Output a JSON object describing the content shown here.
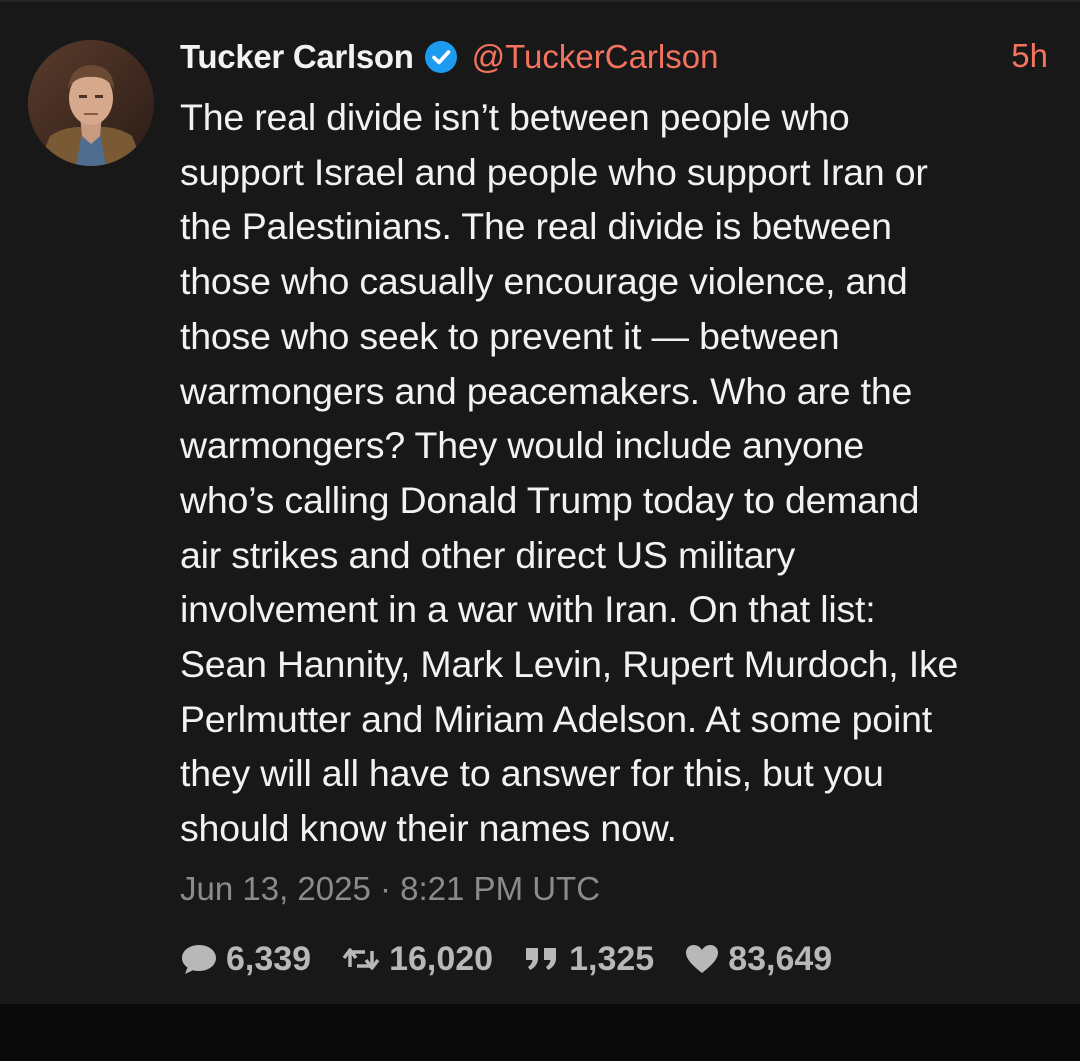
{
  "tweet": {
    "author": {
      "display_name": "Tucker Carlson",
      "handle": "@TuckerCarlson",
      "verified": true
    },
    "time_ago": "5h",
    "text": "The real divide isn’t between people who\nsupport Israel and people who support Iran or\nthe Palestinians. The real divide is between\nthose who casually encourage violence, and\nthose who seek to prevent it — between\nwarmongers and peacemakers. Who are the\nwarmongers? They would include anyone\nwho’s calling Donald Trump today to demand\nair strikes and other direct US military\ninvolvement in a war with Iran. On that list:\nSean Hannity, Mark Levin, Rupert Murdoch, Ike\nPerlmutter and Miriam Adelson. At some point\nthey will all have to answer for this, but you\nshould know their names now.",
    "timestamp": "Jun 13, 2025 · 8:21 PM UTC",
    "stats": {
      "replies": "6,339",
      "retweets": "16,020",
      "quotes": "1,325",
      "likes": "83,649"
    }
  },
  "icons": {
    "verified": "verified-badge-icon",
    "replies": "comment-icon",
    "retweets": "retweet-icon",
    "quotes": "quote-icon",
    "likes": "heart-icon"
  },
  "colors": {
    "background": "#181818",
    "text": "#f2f2f2",
    "accent": "#f4735e",
    "muted": "#8b8b8b",
    "verified": "#1d9bf0"
  }
}
